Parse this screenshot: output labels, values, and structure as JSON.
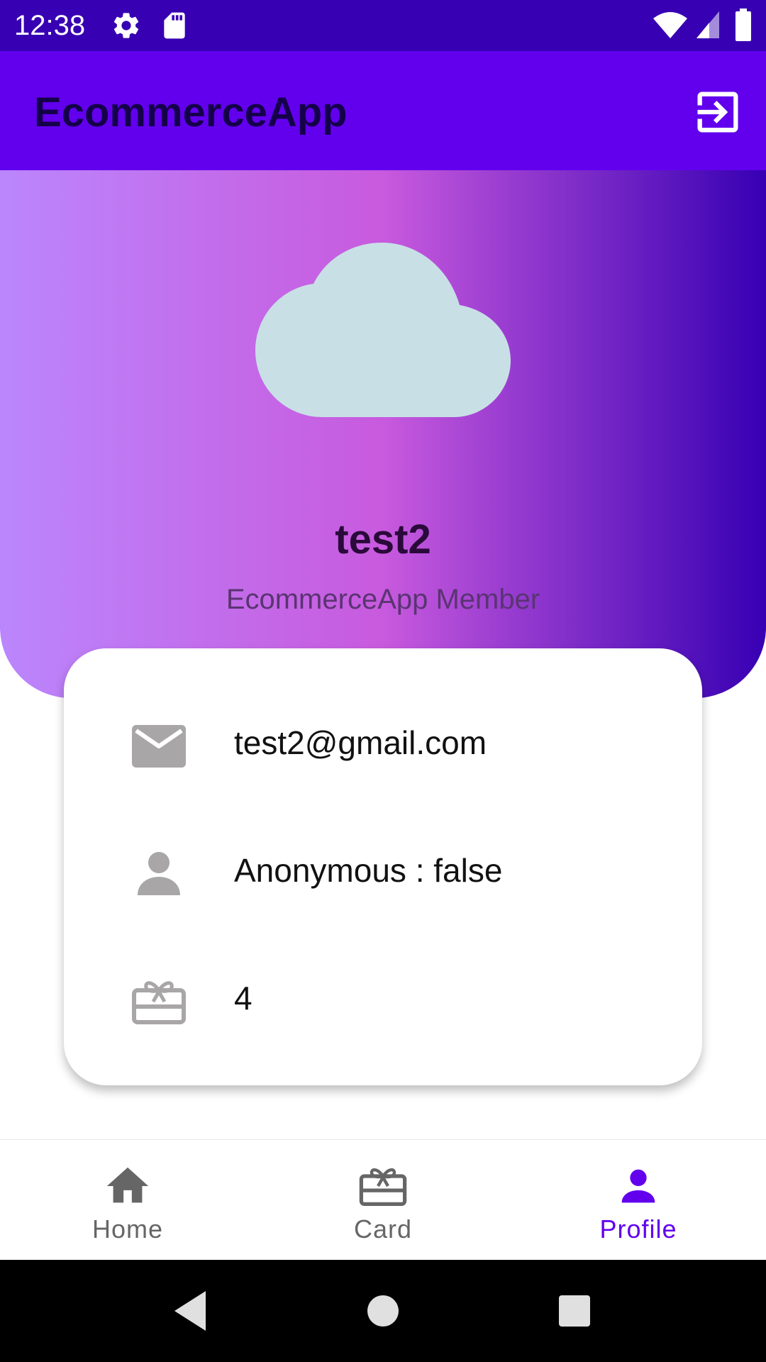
{
  "status_bar": {
    "time": "12:38",
    "icons": [
      "gear-icon",
      "sd-card-icon",
      "wifi-icon",
      "signal-icon",
      "battery-icon"
    ]
  },
  "app_bar": {
    "title": "EcommerceApp",
    "action_icon": "logout-icon"
  },
  "profile": {
    "avatar_icon": "cloud-icon",
    "name": "test2",
    "subtitle": "EcommerceApp Member"
  },
  "info": {
    "rows": [
      {
        "icon": "email-icon",
        "text": "test2@gmail.com"
      },
      {
        "icon": "person-icon",
        "text": "Anonymous : false"
      },
      {
        "icon": "card-giftcard-icon",
        "text": "4"
      }
    ]
  },
  "bottom_nav": {
    "items": [
      {
        "label": "Home",
        "icon": "home-icon",
        "active": false
      },
      {
        "label": "Card",
        "icon": "card-giftcard-icon",
        "active": false
      },
      {
        "label": "Profile",
        "icon": "person-icon",
        "active": true
      }
    ]
  },
  "colors": {
    "status_bar": "#3700b3",
    "app_bar": "#6200ee",
    "accent": "#6200ee",
    "inactive": "#666666",
    "gradient": [
      "#bb86fc",
      "#c85ade",
      "#3700b3"
    ],
    "avatar": "#c9dfe6",
    "row_icon": "#a8a6a6"
  },
  "system_nav": [
    "back-icon",
    "home-circle-icon",
    "recents-icon"
  ]
}
